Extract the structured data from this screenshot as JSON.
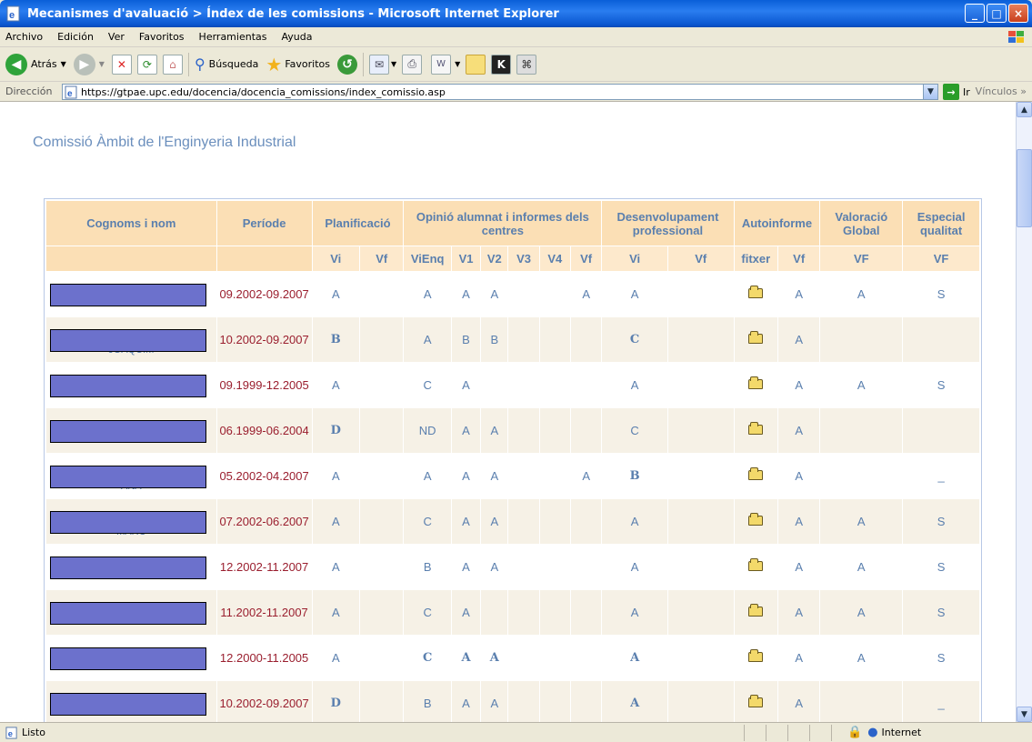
{
  "window": {
    "title": "Mecanismes d'avaluació > Índex de les comissions - Microsoft Internet Explorer"
  },
  "menu": [
    "Archivo",
    "Edición",
    "Ver",
    "Favoritos",
    "Herramientas",
    "Ayuda"
  ],
  "toolbar": {
    "back_label": "Atrás",
    "search_label": "Búsqueda",
    "favorites_label": "Favoritos"
  },
  "address": {
    "label": "Dirección",
    "url": "https://gtpae.upc.edu/docencia/docencia_comissions/index_comissio.asp",
    "go_label": "Ir",
    "links_label": "Vínculos"
  },
  "page": {
    "title": "Comissió Àmbit de l'Enginyeria Industrial"
  },
  "table": {
    "headers": [
      "Cognoms i nom",
      "Període",
      "Planificació",
      "Opinió alumnat i informes dels centres",
      "Desenvolupament professional",
      "Autoinforme",
      "Valoració Global",
      "Especial qualitat"
    ],
    "subheaders": [
      "",
      "",
      "Vi",
      "Vf",
      "ViEnq",
      "V1",
      "V2",
      "V3",
      "V4",
      "Vf",
      "Vi",
      "Vf",
      "fitxer",
      "Vf",
      "VF",
      "VF"
    ],
    "rows": [
      {
        "period": "09.2002-09.2007",
        "cells": [
          "A",
          "",
          "A",
          "A",
          "A",
          "",
          "",
          "A",
          "A",
          "",
          "folder",
          "A",
          "A",
          "S"
        ],
        "styles": [
          "",
          "",
          "",
          "",
          "",
          "",
          "",
          "",
          "",
          "",
          "",
          "",
          "",
          ""
        ]
      },
      {
        "period": "10.2002-09.2007",
        "cells": [
          "B",
          "",
          "A",
          "B",
          "B",
          "",
          "",
          "",
          "C",
          "",
          "folder",
          "A",
          "",
          ""
        ],
        "styles": [
          "b",
          "",
          "",
          "",
          "",
          "",
          "",
          "",
          "b",
          "",
          "",
          "",
          "",
          ""
        ],
        "name_hint": "JOAQUIM"
      },
      {
        "period": "09.1999-12.2005",
        "cells": [
          "A",
          "",
          "C",
          "A",
          "",
          "",
          "",
          "",
          "A",
          "",
          "folder",
          "A",
          "A",
          "S"
        ],
        "styles": [
          "",
          "",
          "",
          "",
          "",
          "",
          "",
          "",
          "",
          "",
          "",
          "",
          "",
          ""
        ]
      },
      {
        "period": "06.1999-06.2004",
        "cells": [
          "D",
          "",
          "ND",
          "A",
          "A",
          "",
          "",
          "",
          "C",
          "",
          "folder",
          "A",
          "",
          ""
        ],
        "styles": [
          "red",
          "",
          "",
          "",
          "",
          "",
          "",
          "",
          "",
          "",
          "",
          "",
          "",
          ""
        ]
      },
      {
        "period": "05.2002-04.2007",
        "cells": [
          "A",
          "",
          "A",
          "A",
          "A",
          "",
          "",
          "A",
          "B",
          "",
          "folder",
          "A",
          "",
          "_"
        ],
        "styles": [
          "",
          "",
          "",
          "",
          "",
          "",
          "",
          "",
          "b",
          "",
          "",
          "",
          "",
          ""
        ],
        "name_hint": "ANA"
      },
      {
        "period": "07.2002-06.2007",
        "cells": [
          "A",
          "",
          "C",
          "A",
          "A",
          "",
          "",
          "",
          "A",
          "",
          "folder",
          "A",
          "A",
          "S"
        ],
        "styles": [
          "",
          "",
          "",
          "",
          "",
          "",
          "",
          "",
          "",
          "",
          "",
          "",
          "",
          ""
        ],
        "name_hint": "MARC"
      },
      {
        "period": "12.2002-11.2007",
        "cells": [
          "A",
          "",
          "B",
          "A",
          "A",
          "",
          "",
          "",
          "A",
          "",
          "folder",
          "A",
          "A",
          "S"
        ],
        "styles": [
          "",
          "",
          "",
          "",
          "",
          "",
          "",
          "",
          "",
          "",
          "",
          "",
          "",
          ""
        ]
      },
      {
        "period": "11.2002-11.2007",
        "cells": [
          "A",
          "",
          "C",
          "A",
          "",
          "",
          "",
          "",
          "A",
          "",
          "folder",
          "A",
          "A",
          "S"
        ],
        "styles": [
          "",
          "",
          "",
          "",
          "",
          "",
          "",
          "",
          "",
          "",
          "",
          "",
          "",
          ""
        ]
      },
      {
        "period": "12.2000-11.2005",
        "cells": [
          "A",
          "",
          "C",
          "A",
          "A",
          "",
          "",
          "",
          "A",
          "",
          "folder",
          "A",
          "A",
          "S"
        ],
        "styles": [
          "",
          "",
          "b",
          "b",
          "b",
          "",
          "",
          "",
          "b",
          "",
          "",
          "",
          "",
          ""
        ]
      },
      {
        "period": "10.2002-09.2007",
        "cells": [
          "D",
          "",
          "B",
          "A",
          "A",
          "",
          "",
          "",
          "A",
          "",
          "folder",
          "A",
          "",
          "_"
        ],
        "styles": [
          "red",
          "",
          "",
          "",
          "",
          "",
          "",
          "",
          "b",
          "",
          "",
          "",
          "",
          ""
        ]
      }
    ]
  },
  "status": {
    "text": "Listo",
    "zone": "Internet"
  },
  "colors": {
    "header": "#fbdfb5",
    "subheader": "#fde9cc",
    "link_text": "#5a7fae",
    "period_text": "#9a1e2e",
    "redaction": "#6c71cc"
  }
}
